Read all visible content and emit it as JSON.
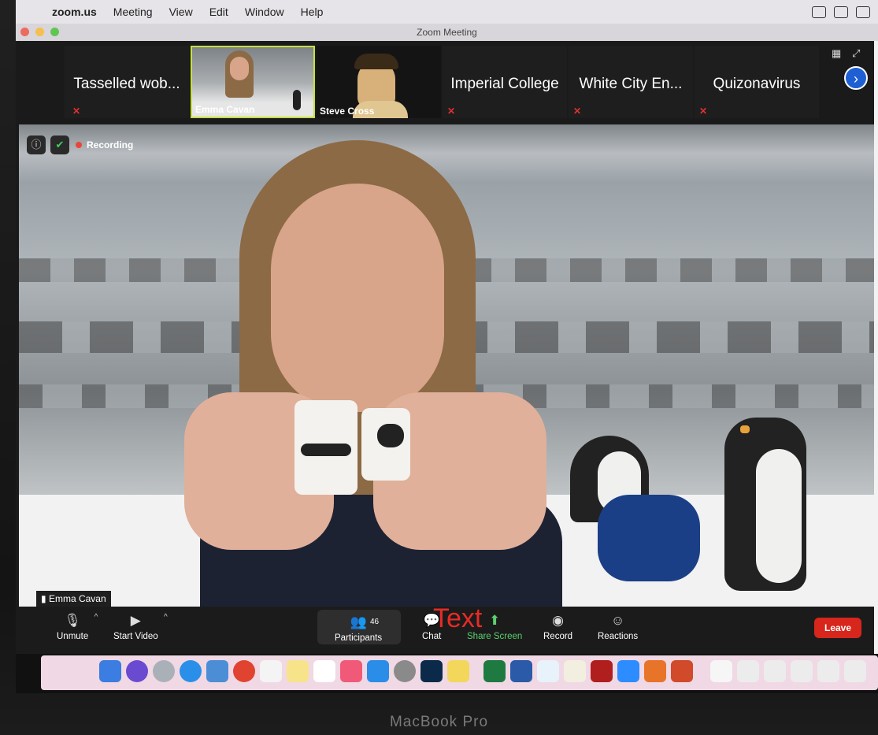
{
  "menubar": {
    "app": "zoom.us",
    "items": [
      "Meeting",
      "View",
      "Edit",
      "Window",
      "Help"
    ]
  },
  "window": {
    "title": "Zoom Meeting"
  },
  "gallery": {
    "tiles": [
      {
        "name": "Tasselled wob...",
        "muted": true
      },
      {
        "name": "Emma Cavan",
        "video": true,
        "active": true
      },
      {
        "name": "Steve Cross",
        "video": true
      },
      {
        "name": "Imperial College",
        "muted": true
      },
      {
        "name": "White City En...",
        "muted": true
      },
      {
        "name": "Quizonavirus",
        "muted": true
      }
    ]
  },
  "main_video": {
    "recording_label": "Recording",
    "speaker_name": "Emma Cavan"
  },
  "toolbar": {
    "unmute": "Unmute",
    "start_video": "Start Video",
    "participants": "Participants",
    "participant_count": "46",
    "chat": "Chat",
    "share_screen": "Share Screen",
    "record": "Record",
    "reactions": "Reactions",
    "leave": "Leave",
    "overlay_text": "Text"
  },
  "laptop": {
    "brand": "MacBook Pro"
  },
  "colors": {
    "accent_blue": "#1f5fd4",
    "leave_red": "#d7261c",
    "share_green": "#5bd06e",
    "active_border": "#c6e03e",
    "recording_red": "#e8463a"
  }
}
